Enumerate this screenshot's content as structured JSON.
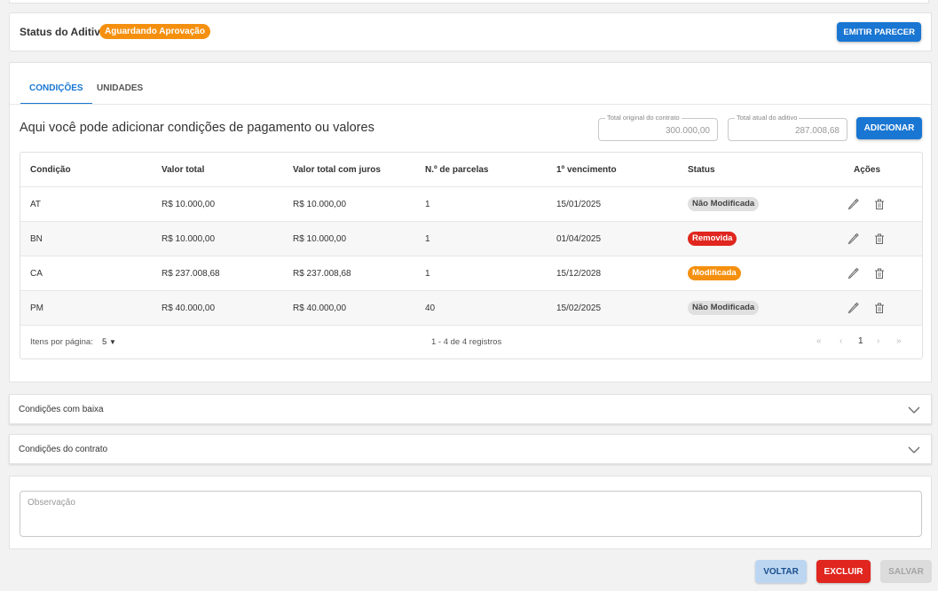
{
  "status": {
    "title": "Status do Aditivo",
    "badge": "Aguardando Aprovação",
    "emit_button": "Emitir Parecer"
  },
  "tabs": [
    {
      "label": "Condições",
      "active": true
    },
    {
      "label": "Unidades",
      "active": false
    }
  ],
  "subtitle": "Aqui você pode adicionar condições de pagamento ou valores",
  "total_original": {
    "label": "Total original do contrato",
    "value": "300.000,00"
  },
  "total_atual": {
    "label": "Total atual do aditivo",
    "value": "287.008,68"
  },
  "add_button": "Adicionar",
  "table": {
    "headers": [
      "Condição",
      "Valor total",
      "Valor total com juros",
      "N.º de parcelas",
      "1º vencimento",
      "Status",
      "Ações"
    ],
    "rows": [
      {
        "condicao": "AT",
        "valor": "R$ 10.000,00",
        "valor_juros": "R$ 10.000,00",
        "parcelas": "1",
        "vencimento": "15/01/2025",
        "status": "Não Modificada",
        "status_color": "#e0e0e0",
        "status_text_color": "#444444"
      },
      {
        "condicao": "BN",
        "valor": "R$ 10.000,00",
        "valor_juros": "R$ 10.000,00",
        "parcelas": "1",
        "vencimento": "01/04/2025",
        "status": "Removida",
        "status_color": "#e0261e",
        "status_text_color": "#ffffff"
      },
      {
        "condicao": "CA",
        "valor": "R$ 237.008,68",
        "valor_juros": "R$ 237.008,68",
        "parcelas": "1",
        "vencimento": "15/12/2028",
        "status": "Modificada",
        "status_color": "#f5900f",
        "status_text_color": "#ffffff"
      },
      {
        "condicao": "PM",
        "valor": "R$ 40.000,00",
        "valor_juros": "R$ 40.000,00",
        "parcelas": "40",
        "vencimento": "15/02/2025",
        "status": "Não Modificada",
        "status_color": "#e0e0e0",
        "status_text_color": "#444444"
      }
    ]
  },
  "pager": {
    "items_label": "Itens por página:",
    "items_value": "5",
    "range": "1 - 4 de 4 registros",
    "page": "1"
  },
  "accordions": [
    {
      "label": "Condições com baixa"
    },
    {
      "label": "Condições do contrato"
    }
  ],
  "observacao": {
    "placeholder": "Observação"
  },
  "footer": {
    "voltar": "Voltar",
    "excluir": "Excluir",
    "salvar": "Salvar"
  },
  "colors": {
    "primary": "#1976d2",
    "warning": "#f5900f",
    "danger": "#e0261e"
  }
}
